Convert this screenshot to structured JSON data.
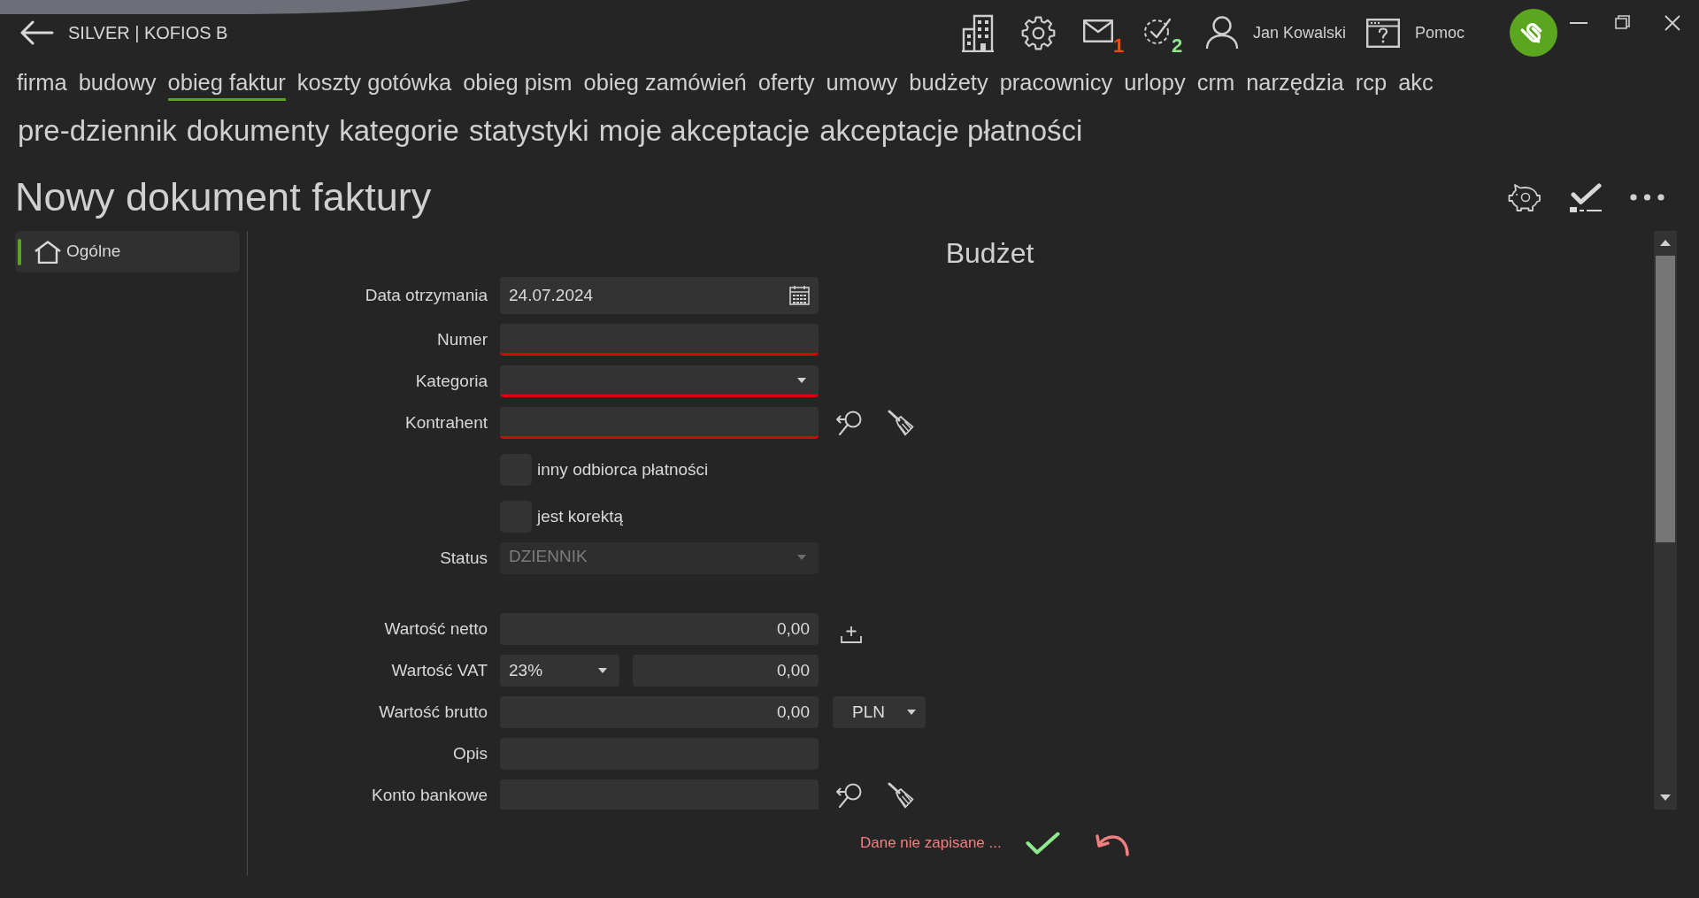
{
  "header": {
    "title": "SILVER | KOFIOS B",
    "mail_count": "1",
    "task_count": "2",
    "user_name": "Jan Kowalski",
    "help_label": "Pomoc"
  },
  "main_nav": [
    {
      "label": "firma",
      "selected": false
    },
    {
      "label": "budowy",
      "selected": false
    },
    {
      "label": "obieg faktur",
      "selected": true
    },
    {
      "label": "koszty gotówka",
      "selected": false
    },
    {
      "label": "obieg pism",
      "selected": false
    },
    {
      "label": "obieg zamówień",
      "selected": false
    },
    {
      "label": "oferty",
      "selected": false
    },
    {
      "label": "umowy",
      "selected": false
    },
    {
      "label": "budżety",
      "selected": false
    },
    {
      "label": "pracownicy",
      "selected": false
    },
    {
      "label": "urlopy",
      "selected": false
    },
    {
      "label": "crm",
      "selected": false
    },
    {
      "label": "narzędzia",
      "selected": false
    },
    {
      "label": "rcp",
      "selected": false
    },
    {
      "label": "akc",
      "selected": false
    }
  ],
  "sub_nav": [
    {
      "label": "pre-dziennik",
      "selected": false
    },
    {
      "label": "dokumenty",
      "selected": false
    },
    {
      "label": "kategorie",
      "selected": false
    },
    {
      "label": "statystyki",
      "selected": false
    },
    {
      "label": "moje akceptacje",
      "selected": false
    },
    {
      "label": "akceptacje płatności",
      "selected": false
    }
  ],
  "page": {
    "title": "Nowy dokument faktury"
  },
  "sidebar": {
    "items": [
      {
        "label": "Ogólne",
        "selected": true
      }
    ]
  },
  "form": {
    "heading": "Budżet",
    "sections": [
      {
        "fields": [
          {
            "kind": "date",
            "label": "Data otrzymania",
            "value": "24.07.2024"
          },
          {
            "kind": "text",
            "label": "Numer",
            "invalid": true
          },
          {
            "kind": "dropdown",
            "label": "Kategoria",
            "invalid": true,
            "disabled": false
          },
          {
            "kind": "lookup",
            "label": "Kontrahent",
            "invalid": true
          },
          {
            "kind": "checkbox",
            "label": "inny odbiorca płatności",
            "checked": false
          },
          {
            "kind": "checkbox",
            "label": "jest korektą",
            "checked": false
          },
          {
            "kind": "dropdown",
            "label": "Status",
            "value": "DZIENNIK",
            "invalid": false,
            "disabled": true
          }
        ]
      },
      {
        "fields": [
          {
            "kind": "amount",
            "label": "Wartość netto",
            "value": "0,00"
          },
          {
            "kind": "vat",
            "label": "Wartość VAT",
            "rate": "23%",
            "value": "0,00"
          },
          {
            "kind": "amount_currency",
            "label": "Wartość brutto",
            "value": "0,00",
            "currency": "PLN"
          },
          {
            "kind": "text",
            "label": "Opis",
            "invalid": false
          },
          {
            "kind": "lookup",
            "label": "Konto bankowe",
            "invalid": false
          }
        ]
      }
    ]
  },
  "footer": {
    "message": "Dane nie zapisane ..."
  }
}
